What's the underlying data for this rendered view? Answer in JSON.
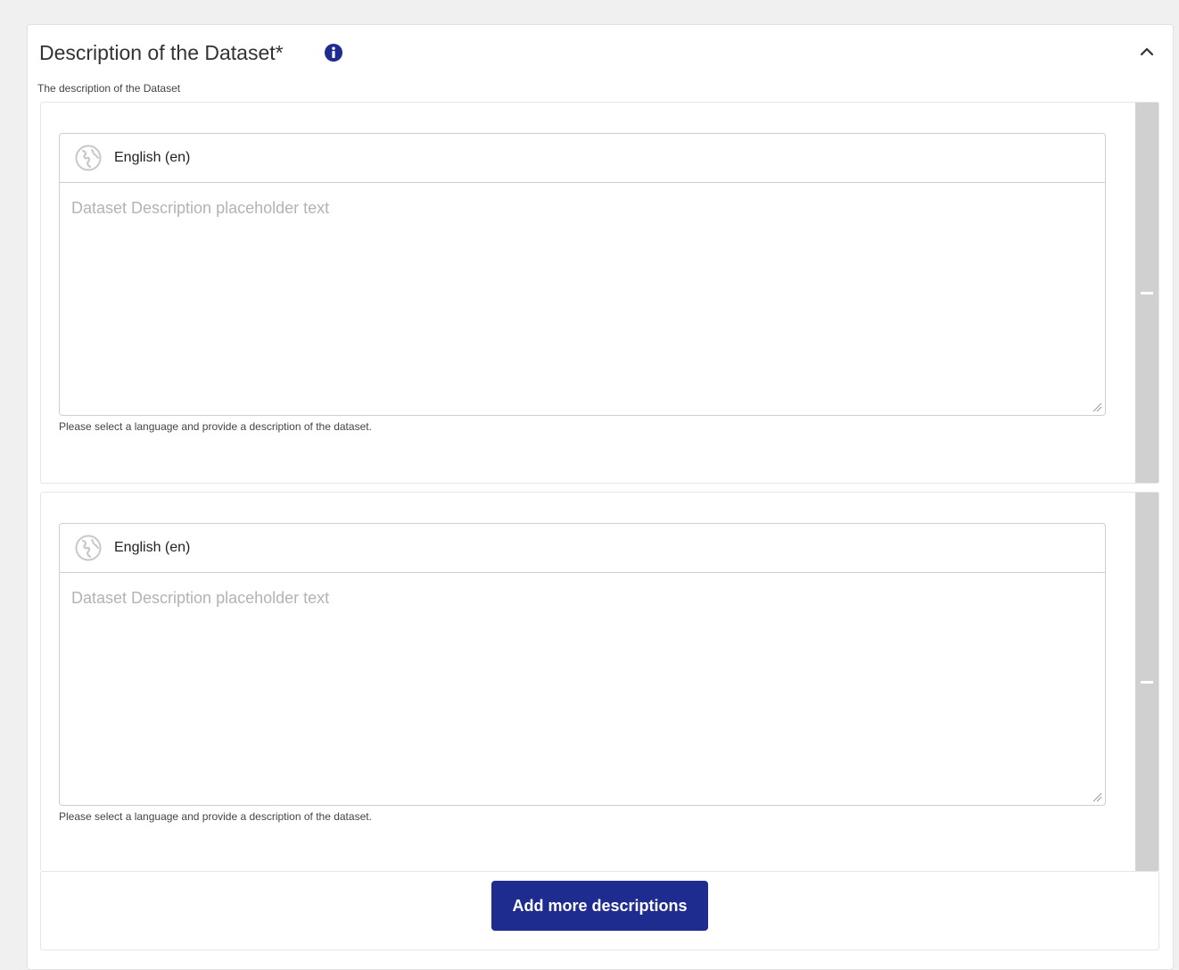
{
  "section": {
    "title": "Description of the Dataset*",
    "subtitle": "The description of the Dataset",
    "info_icon": "info-circle-icon",
    "collapse_icon": "chevron-up-icon"
  },
  "descriptions": [
    {
      "language_label": "English (en)",
      "language_icon": "globe-icon",
      "placeholder": "Dataset Description placeholder text",
      "value": "",
      "help_text": "Please select a language and provide a description of the dataset.",
      "remove_icon": "minus-icon"
    },
    {
      "language_label": "English (en)",
      "language_icon": "globe-icon",
      "placeholder": "Dataset Description placeholder text",
      "value": "",
      "help_text": "Please select a language and provide a description of the dataset.",
      "remove_icon": "minus-icon"
    }
  ],
  "actions": {
    "add_label": "Add more descriptions"
  },
  "colors": {
    "primary": "#1f2c8f",
    "remove_strip": "#d0d0d0",
    "placeholder": "#b3b3b3"
  }
}
